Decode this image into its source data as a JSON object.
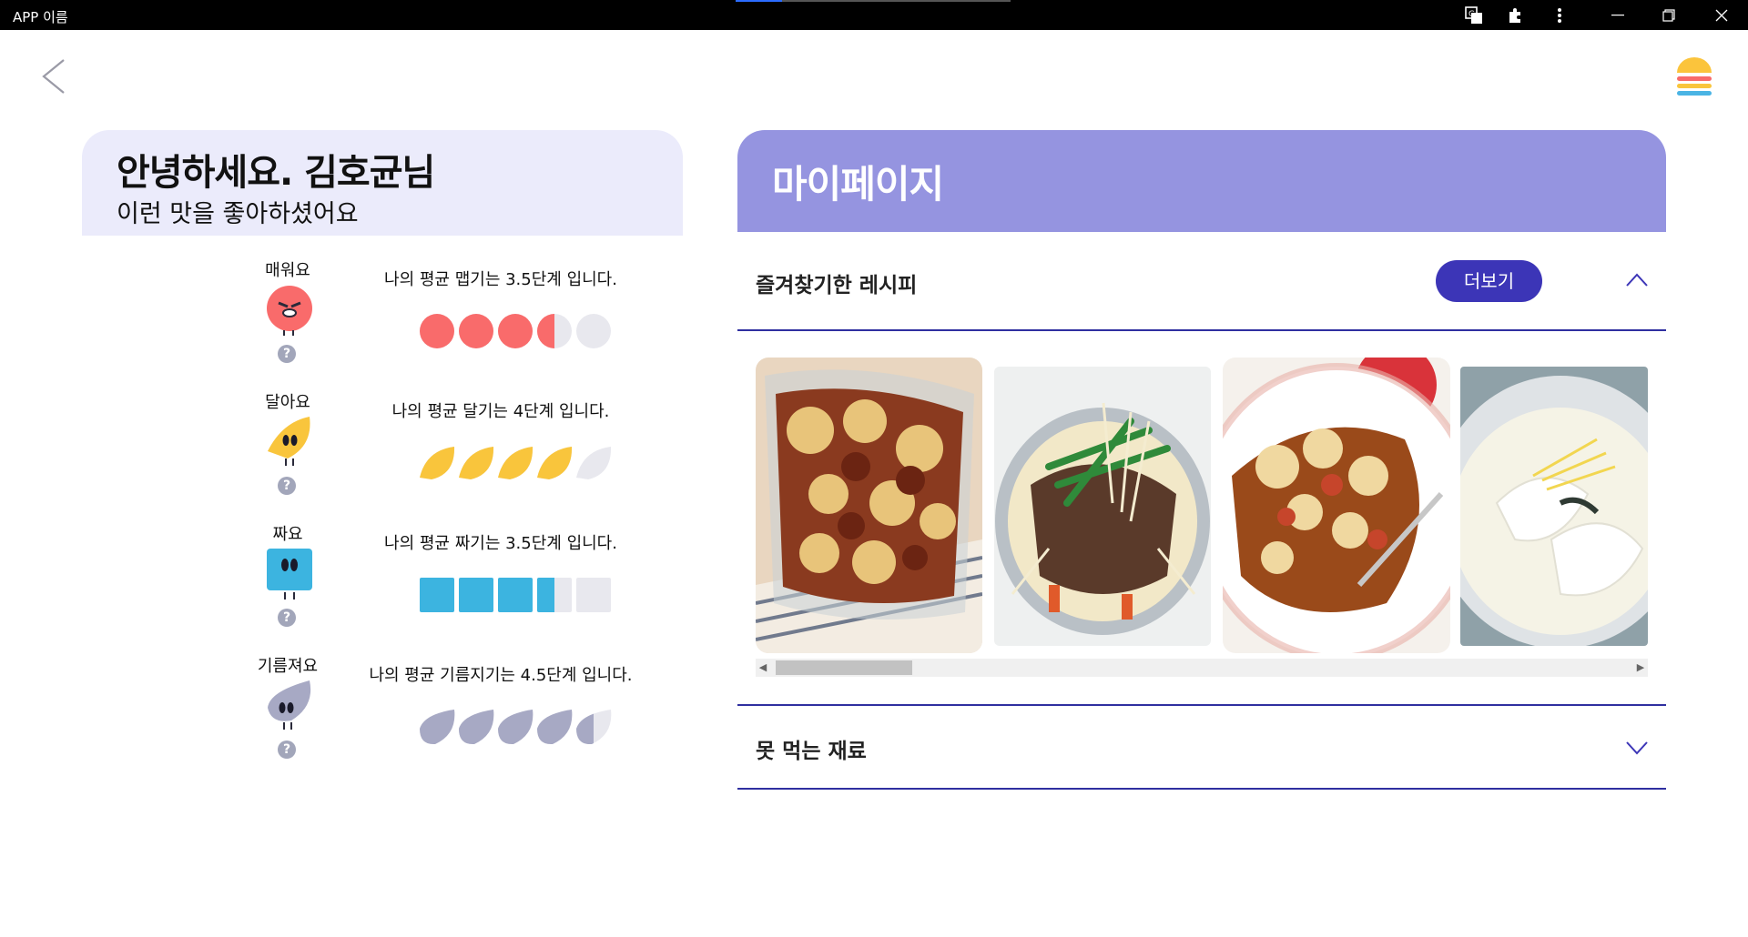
{
  "window": {
    "title": "APP 이름",
    "loading_progress": 0.17
  },
  "greeting": {
    "title": "안녕하세요. 김호균님",
    "subtitle": "이런 맛을 좋아하셨어요"
  },
  "tastes": [
    {
      "label": "매워요",
      "desc": "나의 평균 맵기는 3.5단계 입니다.",
      "level": 3.5,
      "max": 5,
      "shape": "circle",
      "color": "#f96b6b"
    },
    {
      "label": "달아요",
      "desc": "나의 평균 달기는 4단계 입니다.",
      "level": 4,
      "max": 5,
      "shape": "leaf",
      "color": "#f9c53c"
    },
    {
      "label": "짜요",
      "desc": "나의 평균 짜기는 3.5단계 입니다.",
      "level": 3.5,
      "max": 5,
      "shape": "square",
      "color": "#3cb4e0"
    },
    {
      "label": "기름져요",
      "desc": "나의 평균 기름지기는 4.5단계 입니다.",
      "level": 4.5,
      "max": 5,
      "shape": "drop",
      "color": "#a7a9c4"
    }
  ],
  "help_glyph": "?",
  "mypage": {
    "title": "마이페이지",
    "favorites": {
      "title": "즐겨찾기한 레시피",
      "more_label": "더보기",
      "expanded": true,
      "recipes": [
        {
          "name": "meatball-gratin-photo",
          "palette": [
            "#8a3a1f",
            "#e8c47a",
            "#6b2412"
          ]
        },
        {
          "name": "bulgogi-hotpot-photo",
          "palette": [
            "#5a3a2a",
            "#f2e8c8",
            "#2f8a3a"
          ]
        },
        {
          "name": "cheese-pasta-photo",
          "palette": [
            "#9a4a1a",
            "#f0d8a0",
            "#c6452b"
          ]
        },
        {
          "name": "dumpling-soup-photo",
          "palette": [
            "#dfe3e6",
            "#f5f3e6",
            "#8fa1a8"
          ]
        }
      ]
    },
    "dislikes": {
      "title": "못 먹는 재료",
      "expanded": false
    }
  }
}
